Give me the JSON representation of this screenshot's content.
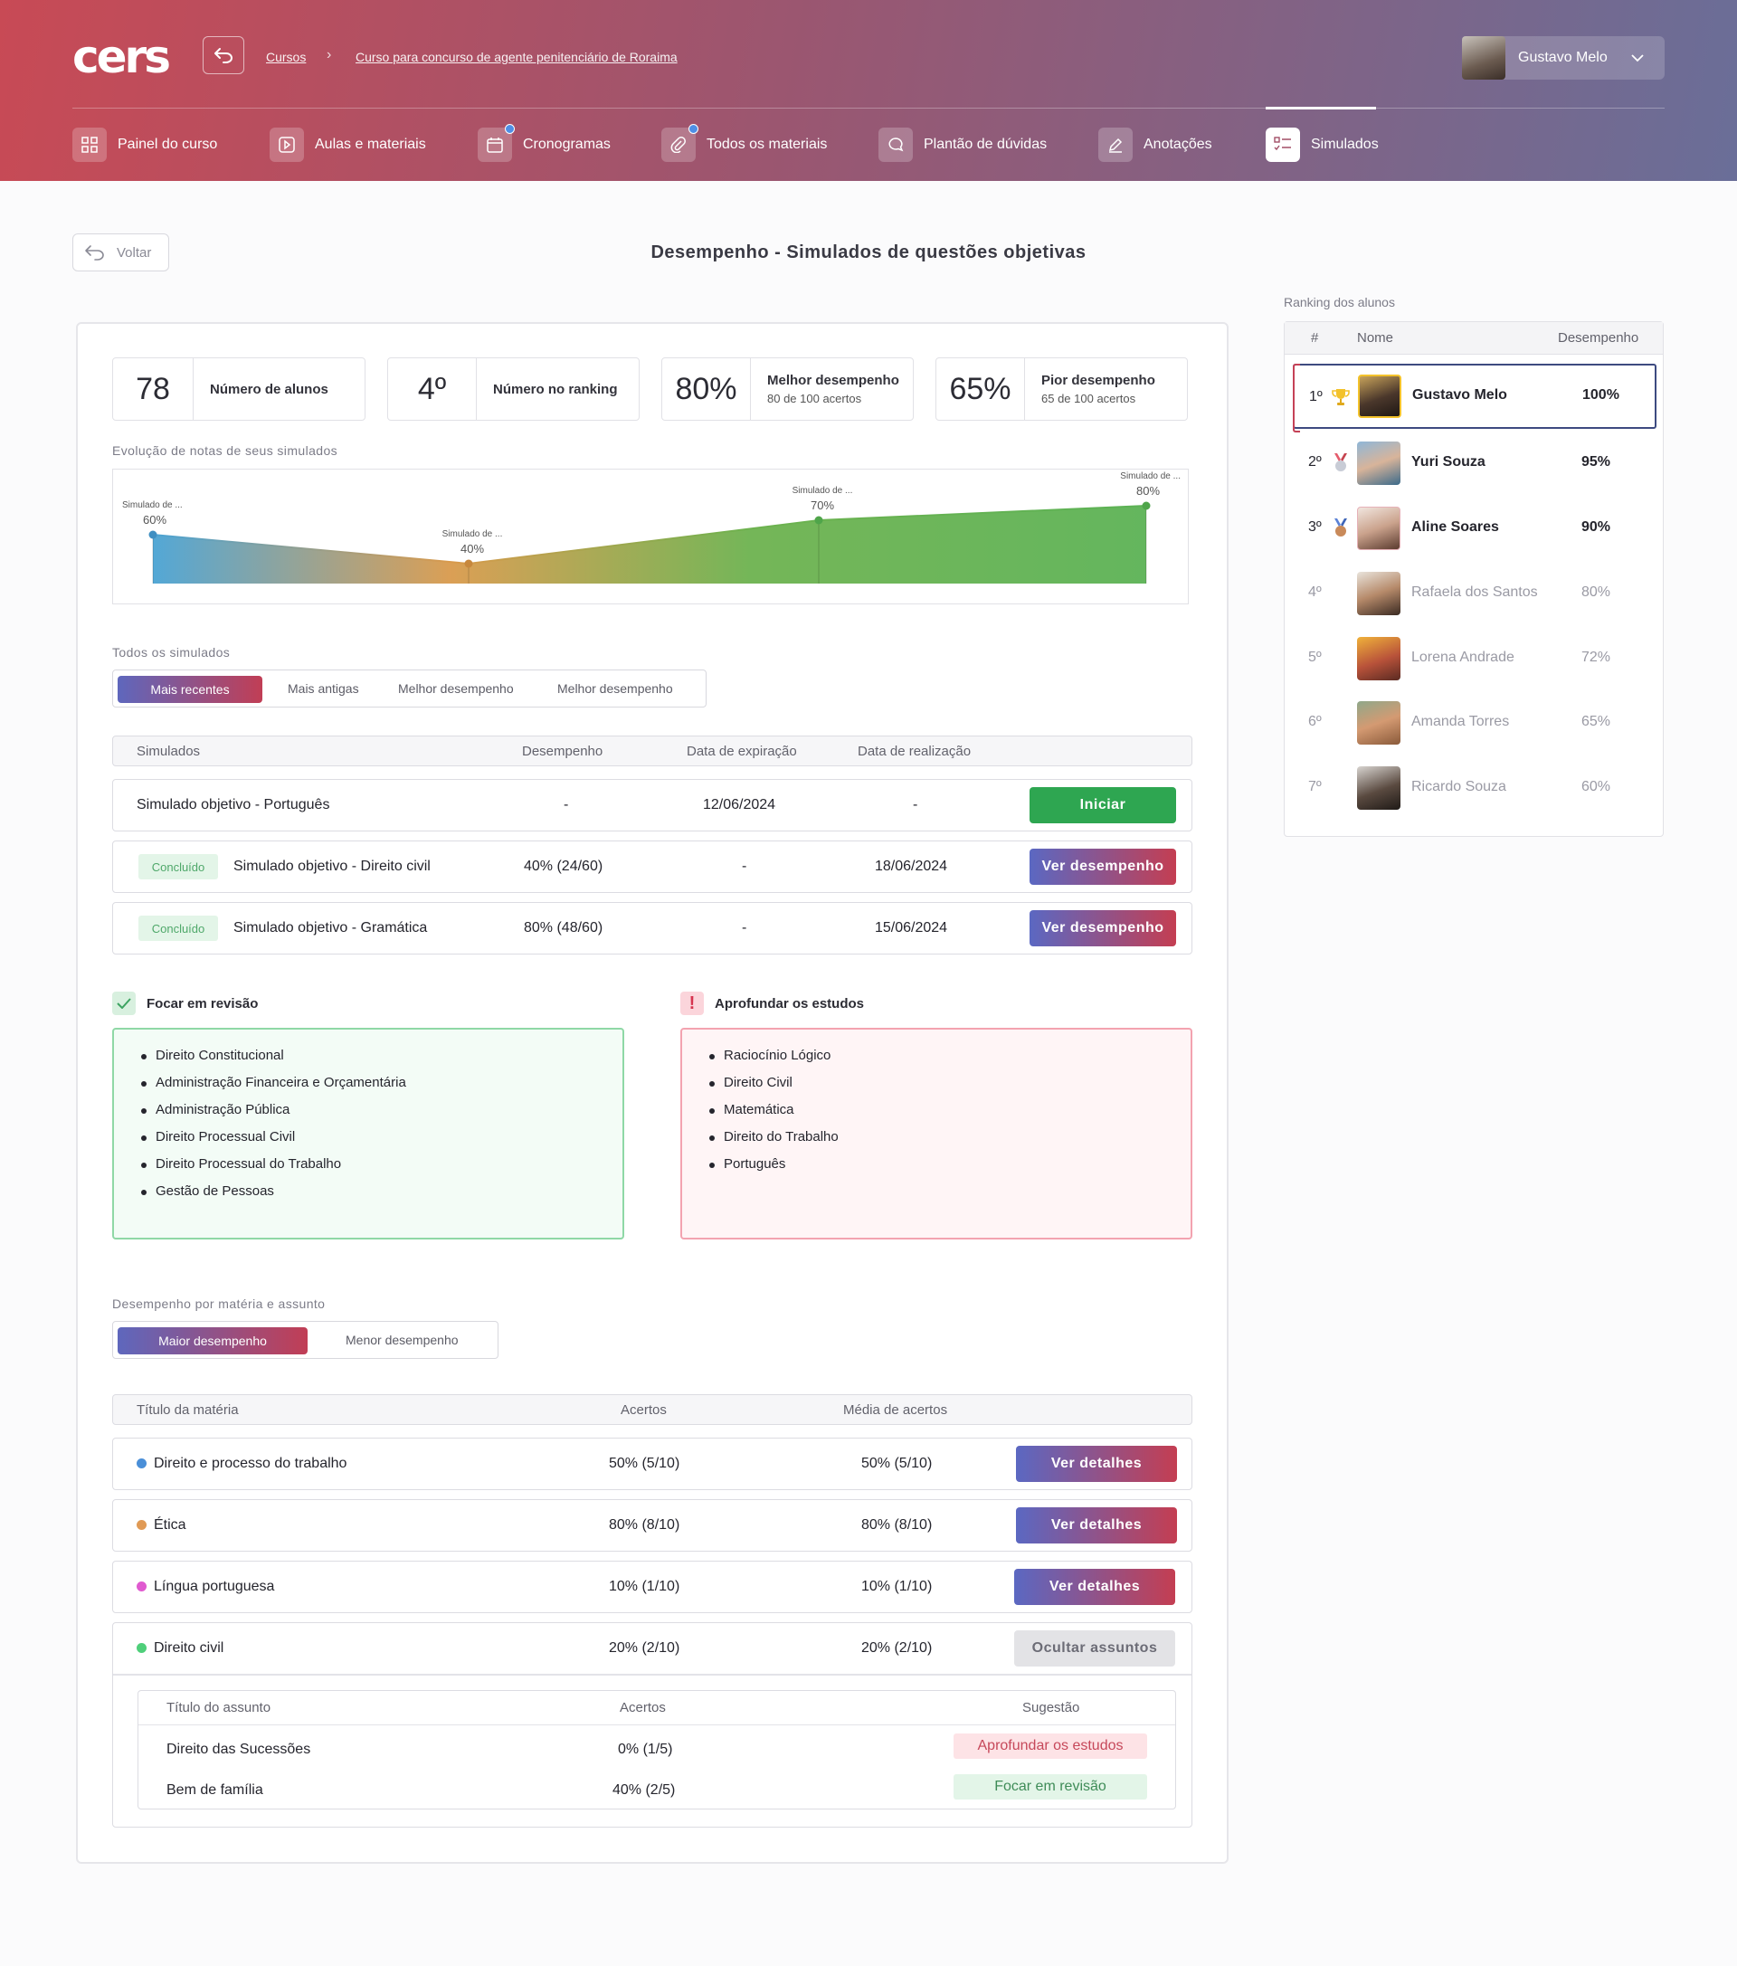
{
  "header": {
    "logo": "cers",
    "breadcrumb": [
      "Cursos",
      "Curso para concurso de agente penitenciário de Roraima"
    ],
    "user_name": "Gustavo Melo",
    "tabs": [
      {
        "label": "Painel do curso",
        "icon": "grid-icon"
      },
      {
        "label": "Aulas e materiais",
        "icon": "play-icon"
      },
      {
        "label": "Cronogramas",
        "icon": "calendar-icon",
        "dot": true
      },
      {
        "label": "Todos os materiais",
        "icon": "paperclip-icon",
        "dot": true
      },
      {
        "label": "Plantão de dúvidas",
        "icon": "chat-icon"
      },
      {
        "label": "Anotações",
        "icon": "pencil-icon"
      },
      {
        "label": "Simulados",
        "icon": "checklist-icon",
        "active": true
      }
    ]
  },
  "page": {
    "back_label": "Voltar",
    "title": "Desempenho - Simulados de questões objetivas"
  },
  "stats": [
    {
      "value": "78",
      "label": "Número de alunos",
      "sub": ""
    },
    {
      "value": "4º",
      "label": "Número no ranking",
      "sub": ""
    },
    {
      "value": "80%",
      "label": "Melhor desempenho",
      "sub": "80 de 100 acertos"
    },
    {
      "value": "65%",
      "label": "Pior desempenho",
      "sub": "65 de 100 acertos"
    }
  ],
  "evolution": {
    "title": "Evolução de notas de seus simulados"
  },
  "chart_data": {
    "type": "area",
    "x": [
      "Simulado de ...",
      "Simulado de ...",
      "Simulado de ...",
      "Simulado de ..."
    ],
    "values": [
      60,
      40,
      70,
      80
    ],
    "value_labels": [
      "60%",
      "40%",
      "70%",
      "80%"
    ],
    "gradient_colors": [
      "#4a9fd0",
      "#d59a4a",
      "#5db255",
      "#5db255"
    ]
  },
  "simulados": {
    "section_title": "Todos os simulados",
    "filters": [
      "Mais recentes",
      "Mais antigas",
      "Melhor desempenho",
      "Melhor desempenho"
    ],
    "columns": [
      "Simulados",
      "Desempenho",
      "Data de expiração",
      "Data de realização"
    ],
    "rows": [
      {
        "badge": "",
        "name": "Simulado objetivo - Português",
        "desempenho": "-",
        "expiracao": "12/06/2024",
        "realizacao": "-",
        "action": "Iniciar"
      },
      {
        "badge": "Concluído",
        "name": "Simulado objetivo - Direito civil",
        "desempenho": "40% (24/60)",
        "expiracao": "-",
        "realizacao": "18/06/2024",
        "action": "Ver desempenho"
      },
      {
        "badge": "Concluído",
        "name": "Simulado objetivo - Gramática",
        "desempenho": "80% (48/60)",
        "expiracao": "-",
        "realizacao": "15/06/2024",
        "action": "Ver desempenho"
      }
    ]
  },
  "focar": {
    "title": "Focar em revisão",
    "items": [
      "Direito Constitucional",
      "Administração Financeira e Orçamentária",
      "Administração Pública",
      "Direito Processual Civil",
      "Direito Processual do Trabalho",
      "Gestão de Pessoas"
    ]
  },
  "aprofundar": {
    "title": "Aprofundar os estudos",
    "items": [
      "Raciocínio Lógico",
      "Direito Civil",
      "Matemática",
      "Direito do Trabalho",
      "Português"
    ]
  },
  "materias": {
    "section_title": "Desempenho por matéria e assunto",
    "filters": [
      "Maior desempenho",
      "Menor desempenho"
    ],
    "columns": [
      "Título da matéria",
      "Acertos",
      "Média de acertos"
    ],
    "rows": [
      {
        "name": "Direito e processo do trabalho",
        "color": "#4a8fd8",
        "acertos": "50% (5/10)",
        "media": "50% (5/10)",
        "action": "Ver detalhes"
      },
      {
        "name": "Ética",
        "color": "#e09a55",
        "acertos": "80% (8/10)",
        "media": "80% (8/10)",
        "action": "Ver detalhes"
      },
      {
        "name": "Língua portuguesa",
        "color": "#e05ad0",
        "acertos": "10% (1/10)",
        "media": "10% (1/10)",
        "action": "Ver detalhes"
      },
      {
        "name": "Direito civil",
        "color": "#4fcf7a",
        "acertos": "20% (2/10)",
        "media": "20% (2/10)",
        "action": "Ocultar assuntos"
      }
    ],
    "assuntos": {
      "columns": [
        "Título do assunto",
        "Acertos",
        "Sugestão"
      ],
      "rows": [
        {
          "name": "Direito das Sucessões",
          "acertos": "0% (1/5)",
          "sugestao": "Aprofundar os estudos"
        },
        {
          "name": "Bem de família",
          "acertos": "40% (2/5)",
          "sugestao": "Focar em revisão"
        }
      ]
    }
  },
  "ranking": {
    "title": "Ranking dos alunos",
    "columns": [
      "#",
      "Nome",
      "Desempenho"
    ],
    "rows": [
      {
        "pos": "1º",
        "name": "Gustavo Melo",
        "perf": "100%",
        "medal": "trophy-icon"
      },
      {
        "pos": "2º",
        "name": "Yuri Souza",
        "perf": "95%",
        "medal": "silver-medal-icon"
      },
      {
        "pos": "3º",
        "name": "Aline Soares",
        "perf": "90%",
        "medal": "bronze-medal-icon"
      },
      {
        "pos": "4º",
        "name": "Rafaela dos Santos",
        "perf": "80%",
        "medal": ""
      },
      {
        "pos": "5º",
        "name": "Lorena Andrade",
        "perf": "72%",
        "medal": ""
      },
      {
        "pos": "6º",
        "name": "Amanda Torres",
        "perf": "65%",
        "medal": ""
      },
      {
        "pos": "7º",
        "name": "Ricardo Souza",
        "perf": "60%",
        "medal": ""
      }
    ]
  }
}
